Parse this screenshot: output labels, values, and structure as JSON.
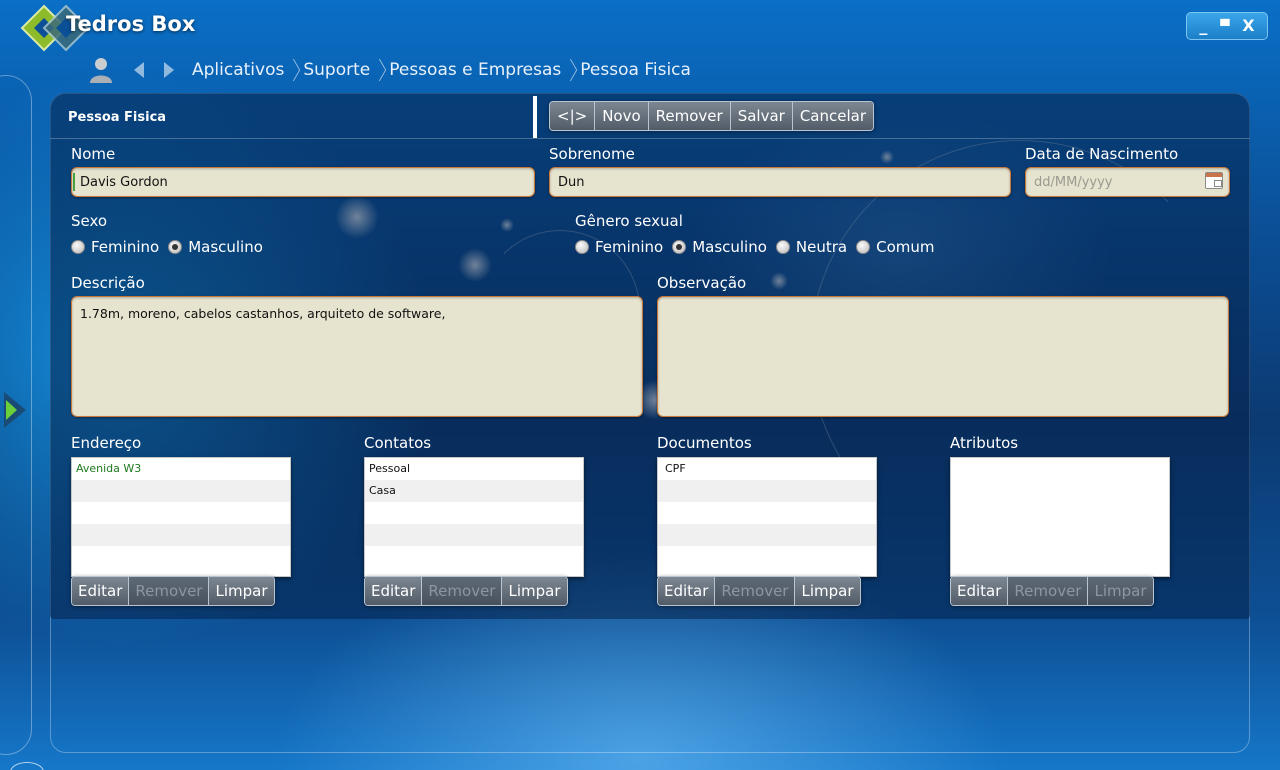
{
  "app": {
    "title": "Tedros Box"
  },
  "window_controls": {
    "minimize": "_",
    "maximize": "▀",
    "close": "X"
  },
  "breadcrumb": [
    "Aplicativos",
    "Suporte",
    "Pessoas e Empresas",
    "Pessoa Fisica"
  ],
  "panel": {
    "title": "Pessoa Fisica"
  },
  "toolbar": {
    "toggle_label": "<|>",
    "new_label": "Novo",
    "remove_label": "Remover",
    "save_label": "Salvar",
    "cancel_label": "Cancelar"
  },
  "form": {
    "nome": {
      "label": "Nome",
      "value": "Davis Gordon"
    },
    "sobrenome": {
      "label": "Sobrenome",
      "value": "Dun"
    },
    "nascimento": {
      "label": "Data de Nascimento",
      "placeholder": "dd/MM/yyyy"
    },
    "sexo": {
      "label": "Sexo",
      "options": [
        "Feminino",
        "Masculino"
      ],
      "selected": "Masculino"
    },
    "genero": {
      "label": "Gênero sexual",
      "options": [
        "Feminino",
        "Masculino",
        "Neutra",
        "Comum"
      ],
      "selected": "Masculino"
    },
    "descricao": {
      "label": "Descrição",
      "value": "1.78m, moreno, cabelos castanhos, arquiteto de software,"
    },
    "observacao": {
      "label": "Observação",
      "value": ""
    }
  },
  "lists": {
    "endereco": {
      "label": "Endereço",
      "items": [
        "Avenida W3"
      ]
    },
    "contatos": {
      "label": "Contatos",
      "items": [
        "Pessoal",
        "Casa"
      ]
    },
    "documentos": {
      "label": "Documentos",
      "items": [
        "CPF"
      ]
    },
    "atributos": {
      "label": "Atributos",
      "items": []
    }
  },
  "list_buttons": {
    "edit": "Editar",
    "remove": "Remover",
    "clear": "Limpar"
  },
  "colors": {
    "field_bg": "#e6e4cf",
    "field_border": "#c8783a",
    "button_bg": "#5f6a77",
    "accent_green": "#1e7a1e"
  }
}
